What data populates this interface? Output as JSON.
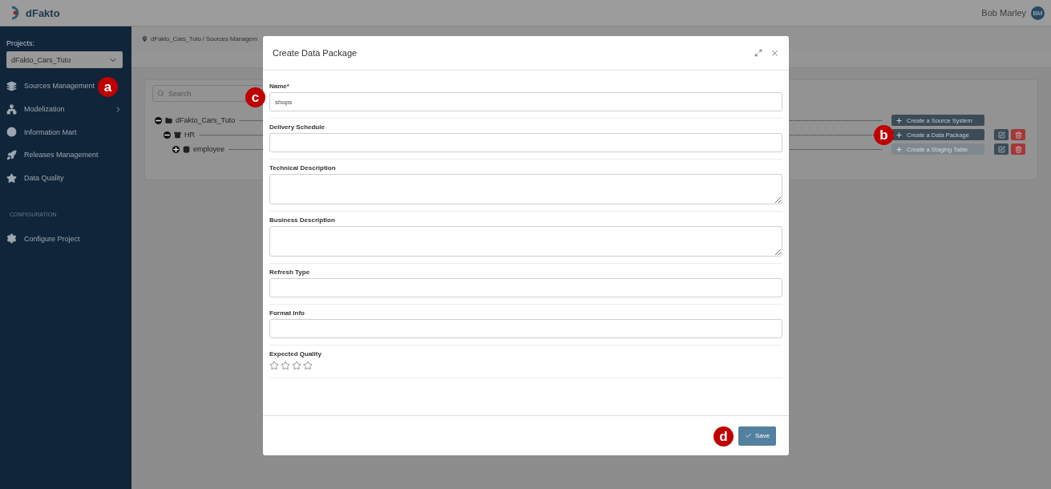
{
  "header": {
    "logo": "dFakto",
    "user": {
      "name": "Bob Marley",
      "initials": "BM"
    }
  },
  "sidebar": {
    "projects_label": "Projects:",
    "project_select": {
      "value": "dFakto_Cars_Tuto"
    },
    "items": [
      {
        "label": "Sources Management",
        "has_submenu": false
      },
      {
        "label": "Modelization",
        "has_submenu": true
      },
      {
        "label": "Information Mart",
        "has_submenu": false
      },
      {
        "label": "Releases Management",
        "has_submenu": false
      },
      {
        "label": "Data Quality",
        "has_submenu": false
      }
    ],
    "section_label": "CONFIGURATION",
    "config_items": [
      {
        "label": "Configure Project",
        "has_submenu": false
      }
    ]
  },
  "breadcrumb": "dFakto_Cars_Tuto / Sources Managem",
  "search": {
    "placeholder": "Search"
  },
  "tree": [
    {
      "label": "dFakto_Cars_Tuto",
      "expanded": true,
      "action": {
        "label": "Create a Source System",
        "disabled": false
      },
      "editable": false,
      "children": [
        {
          "label": "HR",
          "expanded": true,
          "action": {
            "label": "Create a Data Package",
            "disabled": false
          },
          "editable": true,
          "children": [
            {
              "label": "employee",
              "expanded": false,
              "action": {
                "label": "Create a Staging Table",
                "disabled": true
              },
              "editable": true
            }
          ]
        }
      ]
    }
  ],
  "dialog": {
    "title": "Create Data Package",
    "fields": [
      {
        "kind": "input",
        "label": "Name*",
        "value": "shops"
      },
      {
        "kind": "input",
        "label": "Delivery Schedule"
      },
      {
        "kind": "textarea",
        "label": "Technical Description"
      },
      {
        "kind": "textarea",
        "label": "Business Description"
      },
      {
        "kind": "input",
        "label": "Refresh Type"
      },
      {
        "kind": "input",
        "label": "Format Info"
      },
      {
        "kind": "stars",
        "label": "Expected Quality",
        "stars": 0
      }
    ],
    "save_button": "Save"
  },
  "callouts": [
    {
      "label": "a"
    },
    {
      "label": "b"
    },
    {
      "label": "c"
    },
    {
      "label": "d"
    }
  ]
}
